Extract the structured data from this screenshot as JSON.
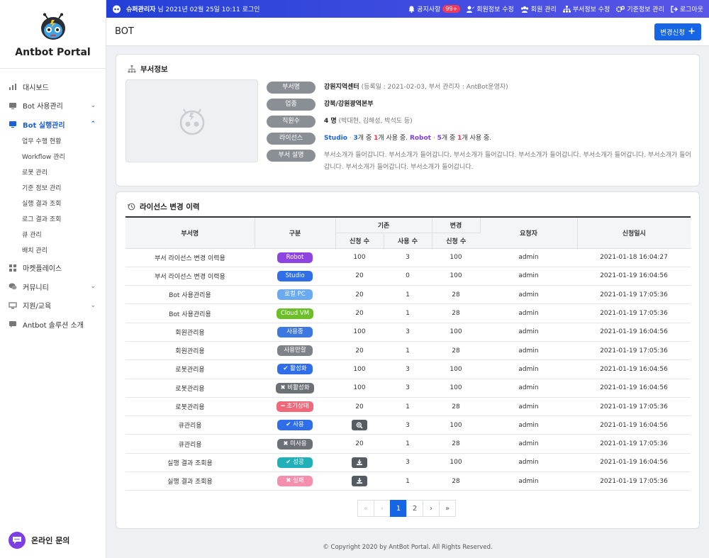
{
  "brand": "Antbot Portal",
  "topbar": {
    "greeting_user": "슈퍼관리자",
    "greeting_suffix": "님 2021년 02월 25일 10:11 로그인",
    "links": [
      {
        "label": "공지사항",
        "badge": "99+",
        "icon": "bell-icon"
      },
      {
        "label": "회원정보 수정",
        "icon": "user-edit-icon"
      },
      {
        "label": "회원 관리",
        "icon": "users-icon"
      },
      {
        "label": "부서정보 수정",
        "icon": "sitemap-icon"
      },
      {
        "label": "기준정보 관리",
        "icon": "gears-icon"
      },
      {
        "label": "로그아웃",
        "icon": "logout-icon"
      }
    ]
  },
  "sidebar": {
    "items": [
      {
        "label": "대시보드",
        "icon": "chart-icon"
      },
      {
        "label": "Bot 사용관리",
        "icon": "monitor-icon"
      },
      {
        "label": "Bot 실행관리",
        "icon": "monitor-icon"
      },
      {
        "label": "마켓플레이스",
        "icon": "grid-icon"
      },
      {
        "label": "커뮤니티",
        "icon": "chat-icon"
      },
      {
        "label": "지원/교육",
        "icon": "desktop-icon"
      },
      {
        "label": "Antbot 솔루션 소개",
        "icon": "comment-icon"
      }
    ],
    "sub_items": [
      "업무 수행 현황",
      "Workflow 관리",
      "로봇 관리",
      "기준 정보 관리",
      "실행 결과 조회",
      "로그 결과 조회",
      "큐 관리",
      "배치 관리"
    ],
    "inquiry": "온라인 문의"
  },
  "header": {
    "title": "BOT",
    "request_button": "변경신청"
  },
  "dept": {
    "title": "부서정보",
    "labels": [
      "부서명",
      "업종",
      "직원수",
      "라이선스",
      "부서 설명"
    ],
    "name": "강원지역센터",
    "name_meta": "(등록일 : 2021-02-03, 부서 관리자 : AntBot운영자)",
    "industry": "강북/강원광역본부",
    "staff_count": "4 명",
    "staff_names": "(박대현, 김해성, 박석도 등)",
    "license": {
      "studio_name": "Studio",
      "studio_total": "3",
      "studio_used": "1",
      "robot_name": "Robot",
      "robot_total": "5",
      "robot_used": "1",
      "sep": "·",
      "unit_total": "개 중",
      "unit_used": "개 사용 중."
    },
    "description": "부서소개가 들어갑니다. 부서소개가 들어갑니다. 부서소개가 들어갑니다. 부서소개가 들어갑니다. 부서소개가 들어갑니다. 부서소개가 들어갑니다. 부서소개가 들어갑니다. 부서소개가 들어갑니다."
  },
  "history": {
    "title": "라이선스 변경 이력",
    "headers": {
      "dept": "부서명",
      "type": "구분",
      "base": "기존",
      "change": "변경",
      "requester": "요청자",
      "date": "신청일시",
      "req_count": "신청 수",
      "use_count": "사용 수",
      "change_req": "신청 수"
    },
    "rows": [
      {
        "dept": "부서 라이선스 변경 이력용",
        "type": "Robot",
        "color": "#8e44e0",
        "req": "100",
        "use": "3",
        "chg": "100",
        "user": "admin",
        "date": "2021-01-18 16:04:27"
      },
      {
        "dept": "부서 라이선스 변경 이력용",
        "type": "Studio",
        "color": "#2f6ee8",
        "req": "20",
        "use": "0",
        "chg": "100",
        "user": "admin",
        "date": "2021-01-19 16:04:56"
      },
      {
        "dept": "Bot 사용관리용",
        "type": "로컬 PC",
        "color": "#6aaaf0",
        "req": "20",
        "use": "1",
        "chg": "28",
        "user": "admin",
        "date": "2021-01-19 17:05:36"
      },
      {
        "dept": "Bot 사용관리용",
        "type": "Cloud VM",
        "color": "#6dbf2a",
        "req": "20",
        "use": "1",
        "chg": "28",
        "user": "admin",
        "date": "2021-01-19 17:05:36"
      },
      {
        "dept": "회원관리용",
        "type": "사용중",
        "color": "#3d78e0",
        "req": "100",
        "use": "3",
        "chg": "100",
        "user": "admin",
        "date": "2021-01-19 16:04:56"
      },
      {
        "dept": "회원관리용",
        "type": "사용만할",
        "color": "#7e838a",
        "req": "20",
        "use": "1",
        "chg": "28",
        "user": "admin",
        "date": "2021-01-19 17:05:36"
      },
      {
        "dept": "로봇관리용",
        "type": "활성화",
        "prefix": "✔",
        "color": "#2f6ee8",
        "req": "100",
        "use": "3",
        "chg": "100",
        "user": "admin",
        "date": "2021-01-19 16:04:56"
      },
      {
        "dept": "로봇관리용",
        "type": "비활성화",
        "prefix": "✖",
        "color": "#6c7178",
        "req": "100",
        "use": "3",
        "chg": "100",
        "user": "admin",
        "date": "2021-01-19 16:04:56"
      },
      {
        "dept": "로봇관리용",
        "type": "초기상태",
        "prefix": "━",
        "color": "#f0697a",
        "req": "20",
        "use": "1",
        "chg": "28",
        "user": "admin",
        "date": "2021-01-19 17:05:36"
      },
      {
        "dept": "큐관리용",
        "type": "사용",
        "prefix": "✔",
        "color": "#2f6ee8",
        "req_icon": "search-plus-icon",
        "req": "",
        "use": "3",
        "chg": "100",
        "user": "admin",
        "date": "2021-01-19 16:04:56"
      },
      {
        "dept": "큐관리용",
        "type": "미사용",
        "prefix": "✖",
        "color": "#6c7178",
        "req": "20",
        "use": "1",
        "chg": "28",
        "user": "admin",
        "date": "2021-01-19 17:05:36"
      },
      {
        "dept": "실행 결과 조회용",
        "type": "성공",
        "prefix": "✔",
        "color": "#1fb0b8",
        "req_icon": "download-icon",
        "req": "",
        "use": "3",
        "chg": "100",
        "user": "admin",
        "date": "2021-01-19 16:04:56"
      },
      {
        "dept": "실행 결과 조회용",
        "type": "실패",
        "prefix": "✖",
        "color": "#f58fae",
        "req_icon": "download-icon",
        "req": "",
        "use": "1",
        "chg": "28",
        "user": "admin",
        "date": "2021-01-19 17:05:36"
      }
    ]
  },
  "pagination": {
    "first": "«",
    "prev": "‹",
    "pages": [
      "1",
      "2"
    ],
    "current": "1",
    "next": "›",
    "last": "»"
  },
  "footer": "© Copyright 2020 by AntBot Portal. All Rights Reserved."
}
